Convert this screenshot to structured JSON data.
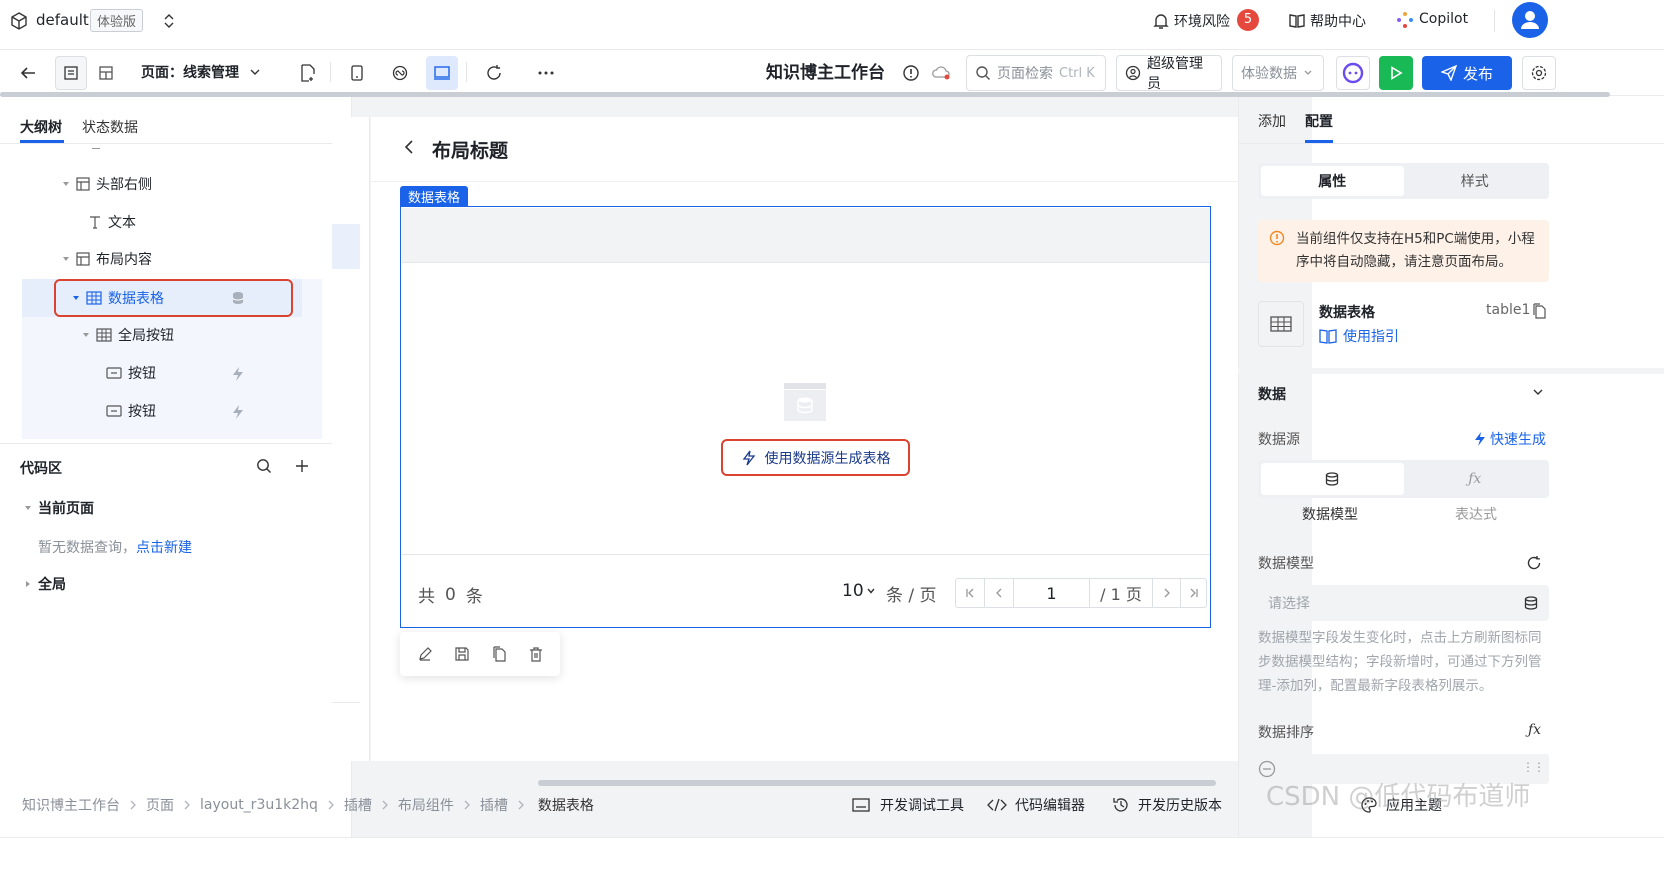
{
  "topbar": {
    "app_name": "default",
    "edition_badge": "体验版",
    "env_risk_label": "环境风险",
    "env_risk_count": "5",
    "help_label": "帮助中心",
    "copilot_label": "Copilot"
  },
  "toolbar": {
    "page_selector": "页面：线索管理",
    "app_title": "知识博主工作台",
    "search_placeholder": "页面检索",
    "search_shortcut": "Ctrl K",
    "role_label": "超级管理员",
    "data_mode": "体验数据",
    "publish_label": "发布"
  },
  "left": {
    "tabs": [
      "大纲树",
      "状态数据"
    ],
    "tree": {
      "header_right": "头部右侧",
      "text": "文本",
      "layout_content": "布局内容",
      "data_table": "数据表格",
      "global_buttons": "全局按钮",
      "button1": "按钮",
      "button2": "按钮"
    },
    "code": {
      "title": "代码区",
      "current_page": "当前页面",
      "empty_text": "暂无数据查询，",
      "create_link": "点击新建",
      "global": "全局"
    }
  },
  "canvas": {
    "layout_title": "布局标题",
    "component_tag": "数据表格",
    "generate_button": "使用数据源生成表格",
    "total_prefix": "共",
    "total_count": "0",
    "total_suffix": "条",
    "page_size": "10",
    "page_size_unit": "条 / 页",
    "current_page": "1",
    "page_total": "/ 1 页"
  },
  "right": {
    "tabs": [
      "添加",
      "配置"
    ],
    "subtabs": [
      "属性",
      "样式"
    ],
    "warning": "当前组件仅支持在H5和PC端使用，小程序中将自动隐藏，请注意页面布局。",
    "component_name": "数据表格",
    "component_id": "table1",
    "usage_guide": "使用指引",
    "section_data": "数据",
    "datasource_label": "数据源",
    "quick_generate": "快速生成",
    "ds_options": [
      "数据模型",
      "表达式"
    ],
    "model_label": "数据模型",
    "model_placeholder": "请选择",
    "model_hint": "数据模型字段发生变化时，点击上方刷新图标同步数据模型结构；字段新增时，可通过下方列管理-添加列，配置最新字段表格列展示。",
    "sort_label": "数据排序"
  },
  "status": {
    "breadcrumb": [
      "知识博主工作台",
      "页面",
      "layout_r3u1k2hq",
      "插槽",
      "布局组件",
      "插槽",
      "数据表格"
    ],
    "dev_tools": "开发调试工具",
    "code_editor": "代码编辑器",
    "dev_history": "开发历史版本",
    "theme": "应用主题"
  },
  "watermark": "CSDN @低代码布道师",
  "colors": {
    "accent": "#1a63e8",
    "danger": "#e5483d",
    "run": "#19b955",
    "highlight_border": "#d9432f"
  }
}
